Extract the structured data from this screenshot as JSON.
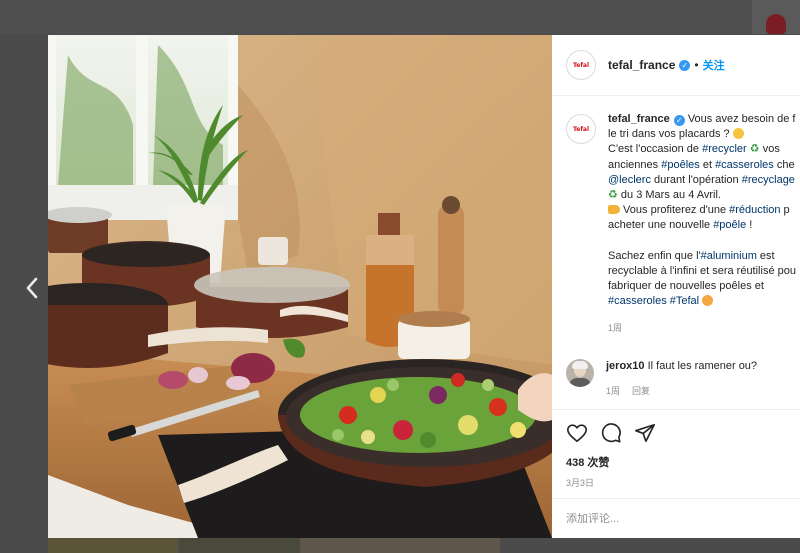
{
  "post": {
    "username": "tefal_france",
    "avatar_logo": "Tefal",
    "header_sep": "•",
    "follow_label": "关注"
  },
  "caption": {
    "l1a": "Vous avez besoin de f",
    "l2a": "le tri dans vos placards ?",
    "l3a": "C'est l'occasion de ",
    "l3tag": "#recycler",
    "l3b": " vos",
    "l4a": "anciennes ",
    "l4tag1": "#poêles",
    "l4b": " et ",
    "l4tag2": "#casseroles",
    "l4c": " che",
    "l5tag": "@leclerc",
    "l5a": " durant l'opération ",
    "l5tag2": "#recyclage",
    "l6a": " du 3 Mars au 4 Avril.",
    "l7a": " Vous profiterez d'une ",
    "l7tag": "#réduction",
    "l7b": " p",
    "l8a": "acheter une nouvelle ",
    "l8tag": "#poêle",
    "l8b": " !",
    "l9a": "Sachez enfin que l'",
    "l9tag": "#aluminium",
    "l9b": " est",
    "l10a": "recyclable à l'infini et sera réutilisé pou",
    "l11a": "fabriquer de nouvelles poêles et",
    "l12tag": "#casseroles",
    "l12b": " ",
    "l12tag2": "#Tefal",
    "timestamp": "1周"
  },
  "comment": {
    "username": "jerox10",
    "text": "Il faut les ramener ou?",
    "timestamp": "1周",
    "reply_label": "回复"
  },
  "stats": {
    "likes": "438 次赞",
    "date": "3月3日"
  },
  "add_comment": {
    "placeholder": "添加评论..."
  },
  "icons": {
    "prev": "chevron-left-icon",
    "like": "heart-icon",
    "comment": "comment-bubble-icon",
    "share": "paper-plane-icon",
    "verified": "verified-badge-icon"
  },
  "colors": {
    "link": "#00376b",
    "accent": "#0095f6",
    "verified": "#3897f0",
    "brand": "#d2111b",
    "muted": "#8e8e8e"
  }
}
